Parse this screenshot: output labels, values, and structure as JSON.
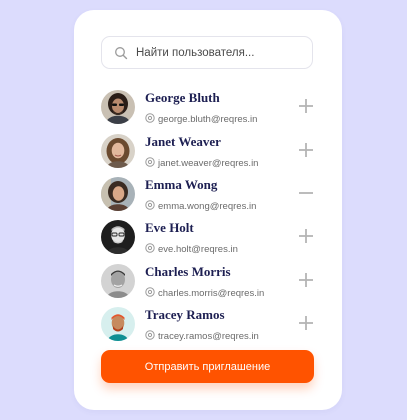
{
  "search": {
    "placeholder": "Найти пользователя...",
    "value": ""
  },
  "users": [
    {
      "name": "George Bluth",
      "email": "george.bluth@reqres.in",
      "invited": false,
      "action_icon": "plus-icon"
    },
    {
      "name": "Janet Weaver",
      "email": "janet.weaver@reqres.in",
      "invited": false,
      "action_icon": "plus-icon"
    },
    {
      "name": "Emma Wong",
      "email": "emma.wong@reqres.in",
      "invited": true,
      "action_icon": "minus-icon"
    },
    {
      "name": "Eve Holt",
      "email": "eve.holt@reqres.in",
      "invited": false,
      "action_icon": "plus-icon"
    },
    {
      "name": "Charles Morris",
      "email": "charles.morris@reqres.in",
      "invited": false,
      "action_icon": "plus-icon"
    },
    {
      "name": "Tracey Ramos",
      "email": "tracey.ramos@reqres.in",
      "invited": false,
      "action_icon": "plus-icon"
    }
  ],
  "send_button": {
    "label": "Отправить приглашение"
  },
  "colors": {
    "background": "#dcdcfd",
    "card": "#ffffff",
    "accent": "#ff5300",
    "name_text": "#1d1f52",
    "email_text": "#6b6b6b",
    "action_icon": "#b4b4b4"
  }
}
